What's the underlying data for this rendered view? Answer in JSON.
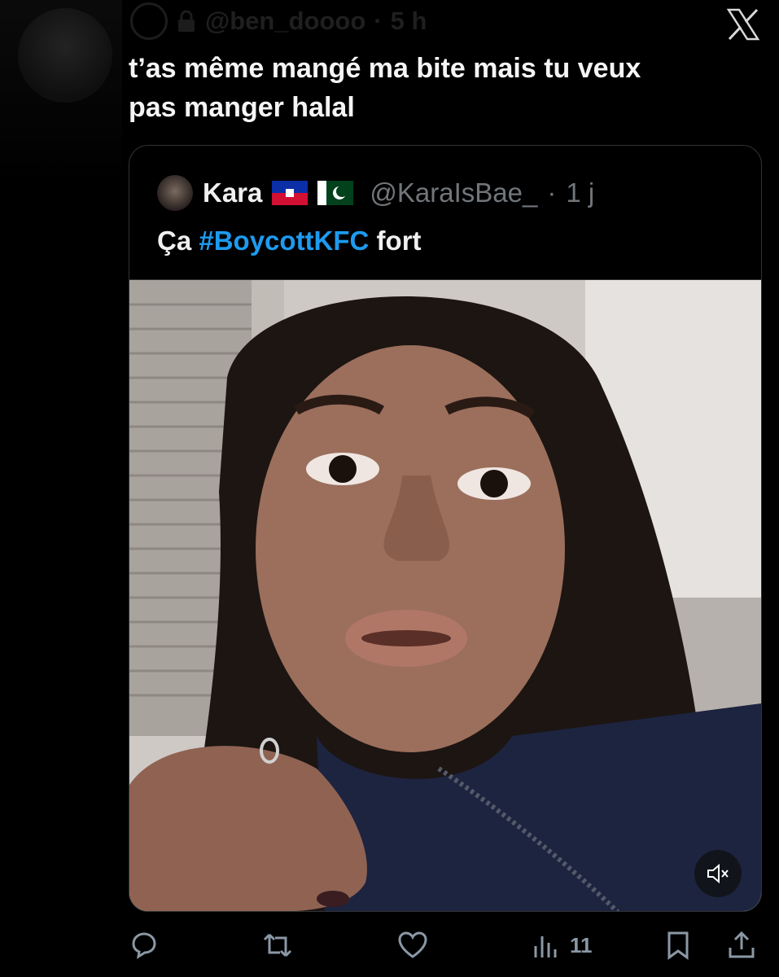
{
  "header": {
    "handle": "@ben_doooo",
    "separator": "·",
    "time": "5 h"
  },
  "tweet": {
    "text": "t’as même mangé ma bite mais tu veux\npas manger halal"
  },
  "quote": {
    "name": "Kara",
    "flags": [
      "haiti-flag",
      "pakistan-flag"
    ],
    "handle": "@KaraIsBae_",
    "separator": "·",
    "time": "1 j",
    "text_prefix": "Ça ",
    "hashtag": "#BoycottKFC",
    "text_suffix": " fort"
  },
  "actions": {
    "views": "11"
  },
  "icons": {
    "close": "x-logo-close-icon",
    "mute": "speaker-muted-icon",
    "reply": "reply-icon",
    "retweet": "retweet-icon",
    "like": "heart-icon",
    "views": "bar-chart-icon",
    "bookmark": "bookmark-icon",
    "share": "share-icon"
  },
  "colors": {
    "background": "#000000",
    "hashtag": "#1d9bf0",
    "muted_text": "#71767b",
    "icon": "#8b98a5"
  }
}
